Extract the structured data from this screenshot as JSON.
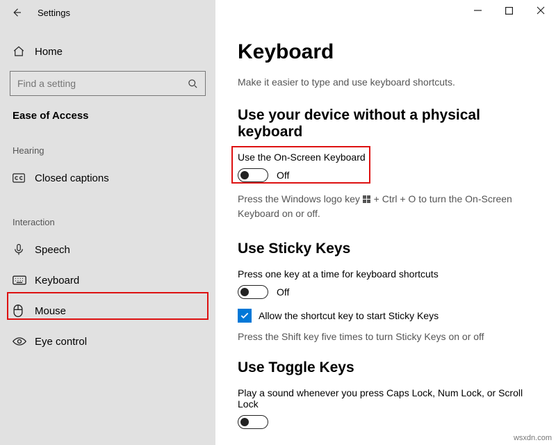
{
  "app_title": "Settings",
  "home_label": "Home",
  "search_placeholder": "Find a setting",
  "section_title": "Ease of Access",
  "groups": {
    "hearing": "Hearing",
    "interaction": "Interaction"
  },
  "nav": {
    "closed_captions": "Closed captions",
    "speech": "Speech",
    "keyboard": "Keyboard",
    "mouse": "Mouse",
    "eye_control": "Eye control"
  },
  "page": {
    "title": "Keyboard",
    "subtitle": "Make it easier to type and use keyboard shortcuts.",
    "sec1_title": "Use your device without a physical keyboard",
    "osk_label": "Use the On-Screen Keyboard",
    "osk_state": "Off",
    "osk_hint_a": "Press the Windows logo key ",
    "osk_hint_b": " + Ctrl + O to turn the On-Screen Keyboard on or off.",
    "sec2_title": "Use Sticky Keys",
    "sticky_label": "Press one key at a time for keyboard shortcuts",
    "sticky_state": "Off",
    "sticky_cb_label": "Allow the shortcut key to start Sticky Keys",
    "sticky_hint": "Press the Shift key five times to turn Sticky Keys on or off",
    "sec3_title": "Use Toggle Keys",
    "toggle_label": "Play a sound whenever you press Caps Lock, Num Lock, or Scroll Lock"
  },
  "watermark": "wsxdn.com"
}
